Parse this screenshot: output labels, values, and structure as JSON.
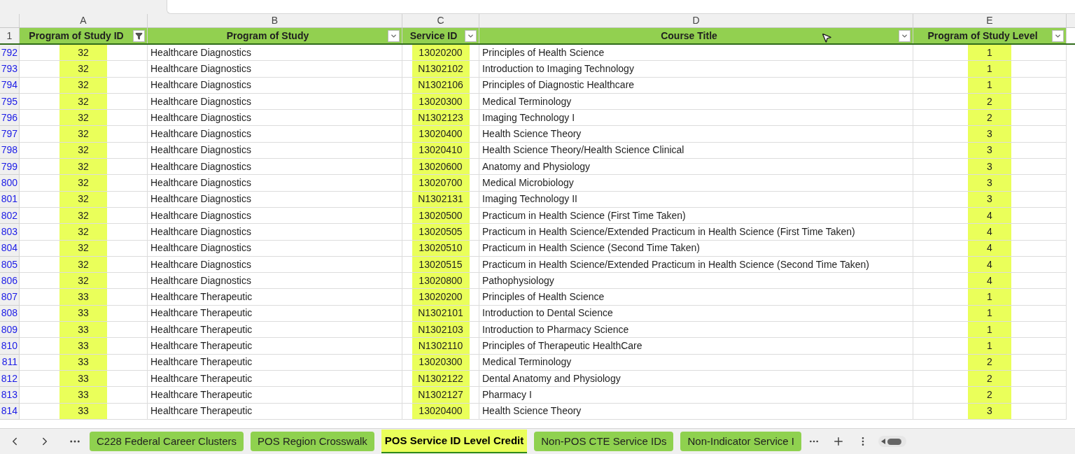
{
  "column_letters": [
    "A",
    "B",
    "C",
    "D",
    "E"
  ],
  "header_row_number": "1",
  "columns": [
    {
      "label": "Program of Study ID",
      "filtered": true
    },
    {
      "label": "Program of Study",
      "filtered": false
    },
    {
      "label": "Service ID",
      "filtered": false
    },
    {
      "label": "Course Title",
      "filtered": false
    },
    {
      "label": "Program of Study Level",
      "filtered": false
    }
  ],
  "rows": [
    {
      "row_number": "792",
      "cells": [
        "32",
        "Healthcare Diagnostics",
        "13020200",
        "Principles of Health Science",
        "1"
      ]
    },
    {
      "row_number": "793",
      "cells": [
        "32",
        "Healthcare Diagnostics",
        "N1302102",
        "Introduction to Imaging Technology",
        "1"
      ]
    },
    {
      "row_number": "794",
      "cells": [
        "32",
        "Healthcare Diagnostics",
        "N1302106",
        "Principles of Diagnostic Healthcare",
        "1"
      ]
    },
    {
      "row_number": "795",
      "cells": [
        "32",
        "Healthcare Diagnostics",
        "13020300",
        "Medical Terminology",
        "2"
      ]
    },
    {
      "row_number": "796",
      "cells": [
        "32",
        "Healthcare Diagnostics",
        "N1302123",
        "Imaging Technology I",
        "2"
      ]
    },
    {
      "row_number": "797",
      "cells": [
        "32",
        "Healthcare Diagnostics",
        "13020400",
        "Health Science Theory",
        "3"
      ]
    },
    {
      "row_number": "798",
      "cells": [
        "32",
        "Healthcare Diagnostics",
        "13020410",
        "Health Science Theory/Health Science Clinical",
        "3"
      ]
    },
    {
      "row_number": "799",
      "cells": [
        "32",
        "Healthcare Diagnostics",
        "13020600",
        "Anatomy and Physiology",
        "3"
      ]
    },
    {
      "row_number": "800",
      "cells": [
        "32",
        "Healthcare Diagnostics",
        "13020700",
        "Medical Microbiology",
        "3"
      ]
    },
    {
      "row_number": "801",
      "cells": [
        "32",
        "Healthcare Diagnostics",
        "N1302131",
        "Imaging Technology II",
        "3"
      ]
    },
    {
      "row_number": "802",
      "cells": [
        "32",
        "Healthcare Diagnostics",
        "13020500",
        "Practicum in Health Science (First Time Taken)",
        "4"
      ]
    },
    {
      "row_number": "803",
      "cells": [
        "32",
        "Healthcare Diagnostics",
        "13020505",
        "Practicum in Health Science/Extended Practicum in Health Science (First Time Taken)",
        "4"
      ]
    },
    {
      "row_number": "804",
      "cells": [
        "32",
        "Healthcare Diagnostics",
        "13020510",
        "Practicum in Health Science (Second Time Taken)",
        "4"
      ]
    },
    {
      "row_number": "805",
      "cells": [
        "32",
        "Healthcare Diagnostics",
        "13020515",
        "Practicum in Health Science/Extended Practicum in Health Science (Second Time Taken)",
        "4"
      ]
    },
    {
      "row_number": "806",
      "cells": [
        "32",
        "Healthcare Diagnostics",
        "13020800",
        "Pathophysiology",
        "4"
      ]
    },
    {
      "row_number": "807",
      "cells": [
        "33",
        "Healthcare Therapeutic",
        "13020200",
        "Principles of Health Science",
        "1"
      ]
    },
    {
      "row_number": "808",
      "cells": [
        "33",
        "Healthcare Therapeutic",
        "N1302101",
        "Introduction to Dental Science",
        "1"
      ]
    },
    {
      "row_number": "809",
      "cells": [
        "33",
        "Healthcare Therapeutic",
        "N1302103",
        "Introduction to Pharmacy Science",
        "1"
      ]
    },
    {
      "row_number": "810",
      "cells": [
        "33",
        "Healthcare Therapeutic",
        "N1302110",
        "Principles of Therapeutic HealthCare",
        "1"
      ]
    },
    {
      "row_number": "811",
      "cells": [
        "33",
        "Healthcare Therapeutic",
        "13020300",
        "Medical Terminology",
        "2"
      ]
    },
    {
      "row_number": "812",
      "cells": [
        "33",
        "Healthcare Therapeutic",
        "N1302122",
        "Dental Anatomy and Physiology",
        "2"
      ]
    },
    {
      "row_number": "813",
      "cells": [
        "33",
        "Healthcare Therapeutic",
        "N1302127",
        "Pharmacy I",
        "2"
      ]
    },
    {
      "row_number": "814",
      "cells": [
        "33",
        "Healthcare Therapeutic",
        "13020400",
        "Health Science Theory",
        "3"
      ]
    }
  ],
  "sheet_tabs": [
    {
      "label": "C228 Federal Career Clusters",
      "selected": false
    },
    {
      "label": "POS Region Crosswalk",
      "selected": false
    },
    {
      "label": "POS Service ID Level Credit",
      "selected": true
    },
    {
      "label": "Non-POS CTE Service IDs",
      "selected": false
    },
    {
      "label": "Non-Indicator Service I",
      "selected": false
    }
  ]
}
